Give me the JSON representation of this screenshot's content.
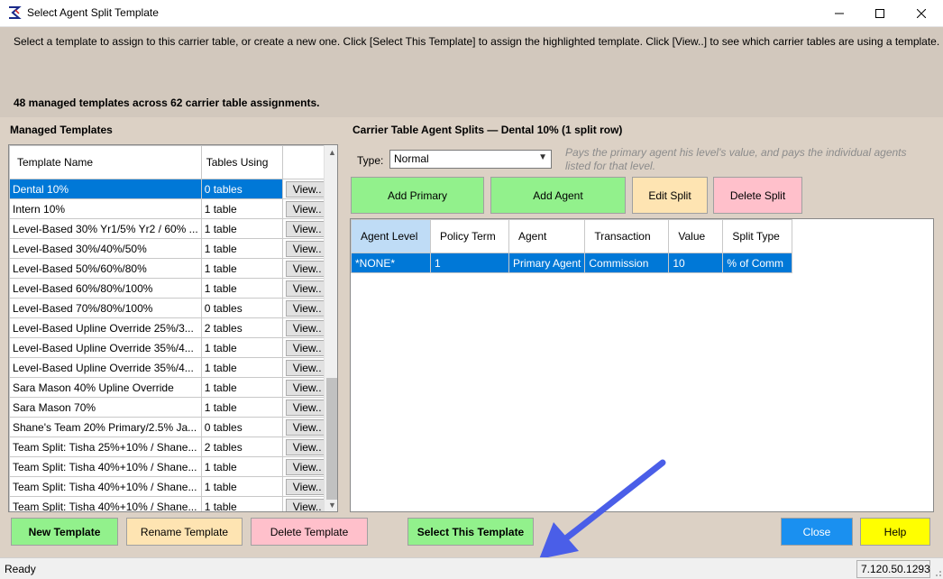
{
  "window": {
    "title": "Select Agent Split Template"
  },
  "instructions": "Select a template to assign to this carrier table, or create a new one. Click [Select This Template] to assign the highlighted template. Click [View..] to see which carrier tables are using a template.",
  "summary": "48 managed templates across 62 carrier table assignments.",
  "managed": {
    "title": "Managed Templates",
    "headers": {
      "name": "Template Name",
      "tables": "Tables Using"
    },
    "view_label": "View..",
    "rows": [
      {
        "name": "Dental 10%",
        "tables": "0 tables"
      },
      {
        "name": "Intern 10%",
        "tables": "1 table"
      },
      {
        "name": "Level-Based 30% Yr1/5% Yr2 / 60% ...",
        "tables": "1 table"
      },
      {
        "name": "Level-Based 30%/40%/50%",
        "tables": "1 table"
      },
      {
        "name": "Level-Based 50%/60%/80%",
        "tables": "1 table"
      },
      {
        "name": "Level-Based 60%/80%/100%",
        "tables": "1 table"
      },
      {
        "name": "Level-Based 70%/80%/100%",
        "tables": "0 tables"
      },
      {
        "name": "Level-Based Upline Override 25%/3...",
        "tables": "2 tables"
      },
      {
        "name": "Level-Based Upline Override 35%/4...",
        "tables": "1 table"
      },
      {
        "name": "Level-Based Upline Override 35%/4...",
        "tables": "1 table"
      },
      {
        "name": "Sara Mason 40% Upline Override",
        "tables": "1 table"
      },
      {
        "name": "Sara Mason 70%",
        "tables": "1 table"
      },
      {
        "name": "Shane's Team 20% Primary/2.5% Ja...",
        "tables": "0 tables"
      },
      {
        "name": "Team Split: Tisha 25%+10% / Shane...",
        "tables": "2 tables"
      },
      {
        "name": "Team Split: Tisha 40%+10% / Shane...",
        "tables": "1 table"
      },
      {
        "name": "Team Split: Tisha 40%+10% / Shane...",
        "tables": "1 table"
      },
      {
        "name": "Team Split: Tisha 40%+10% / Shane...",
        "tables": "1 table"
      }
    ]
  },
  "carrier": {
    "title": "Carrier Table Agent Splits — Dental 10%  (1 split row)",
    "type_label": "Type:",
    "type_value": "Normal",
    "type_desc": "Pays the primary agent his level's value, and pays the individual agents listed for that level.",
    "buttons": {
      "add_primary": "Add Primary",
      "add_agent": "Add Agent",
      "edit_split": "Edit Split",
      "delete_split": "Delete Split"
    },
    "headers": {
      "agent_level": "Agent Level",
      "policy_term": "Policy Term",
      "agent": "Agent",
      "transaction": "Transaction",
      "value": "Value",
      "split_type": "Split Type"
    },
    "rows": [
      {
        "agent_level": "*NONE*",
        "policy_term": "1",
        "agent": "Primary Agent",
        "transaction": "Commission",
        "value": "10",
        "split_type": "% of Comm"
      }
    ]
  },
  "bottom_buttons": {
    "new_template": "New Template",
    "rename_template": "Rename Template",
    "delete_template": "Delete Template",
    "select_template": "Select This Template",
    "close": "Close",
    "help": "Help"
  },
  "status": {
    "left": "Ready",
    "version": "7.120.50.1293"
  },
  "colors": {
    "selection": "#0078d7",
    "green_button": "#92f18c",
    "tan_button": "#fee4b2",
    "pink_button": "#ffc0cb",
    "close_button": "#1a90f0",
    "help_button": "#ffff00",
    "annotation_arrow": "#4a5ee8"
  }
}
